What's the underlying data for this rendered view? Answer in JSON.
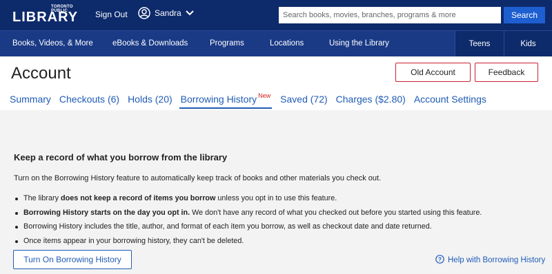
{
  "topbar": {
    "logo_small": "TORONTO PUBLIC",
    "logo_big": "LIBRARY",
    "sign_out": "Sign Out",
    "user_name": "Sandra",
    "search_placeholder": "Search books, movies, branches, programs & more",
    "search_button": "Search"
  },
  "nav": {
    "items": [
      "Books, Videos, & More",
      "eBooks & Downloads",
      "Programs",
      "Locations",
      "Using the Library"
    ],
    "right_items": [
      "Teens",
      "Kids"
    ]
  },
  "header": {
    "title": "Account",
    "old_account": "Old Account",
    "feedback": "Feedback"
  },
  "tabs": [
    {
      "label": "Summary"
    },
    {
      "label": "Checkouts (6)"
    },
    {
      "label": "Holds (20)"
    },
    {
      "label": "Borrowing History",
      "badge": "New",
      "active": true
    },
    {
      "label": "Saved (72)"
    },
    {
      "label": "Charges ($2.80)"
    },
    {
      "label": "Account Settings"
    }
  ],
  "content": {
    "heading": "Keep a record of what you borrow from the library",
    "intro": "Turn on the Borrowing History feature to automatically keep track of books and other materials you check out.",
    "bullets": [
      {
        "pre": "The library ",
        "bold": "does not keep a record of items you borrow",
        "post": " unless you opt in to use this feature."
      },
      {
        "pre": "",
        "bold": "Borrowing History starts on the day you opt in.",
        "post": " We don't have any record of what you checked out before you started using this feature."
      },
      {
        "pre": "Borrowing History includes the title, author, and format of each item you borrow, as well as checkout date and date returned.",
        "bold": "",
        "post": ""
      },
      {
        "pre": "Once items appear in your borrowing history, they can't be deleted.",
        "bold": "",
        "post": ""
      }
    ],
    "turn_on_button": "Turn On Borrowing History",
    "help_link": "Help with Borrowing History"
  },
  "icons": {
    "user": "user-circle-icon",
    "chevron": "chevron-down-icon",
    "help": "question-circle-icon"
  },
  "colors": {
    "topbar": "#0d2a6b",
    "navbar": "#1a3a86",
    "link": "#1f5bb5",
    "accent_red": "#c8202f",
    "search_button": "#1d5fd1"
  }
}
